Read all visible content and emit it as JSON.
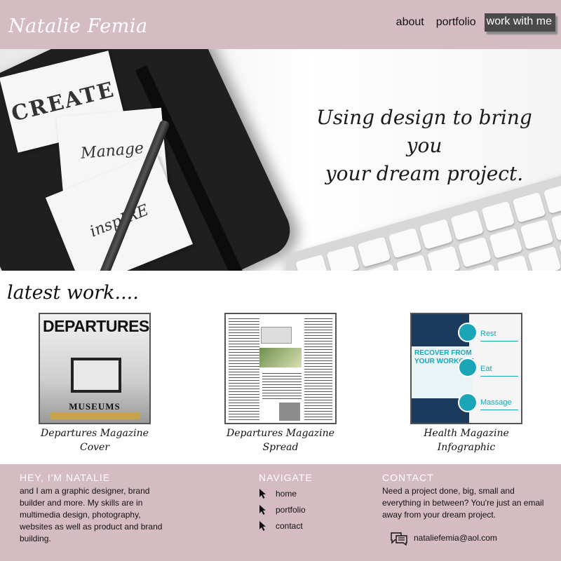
{
  "header": {
    "logo": "Natalie Femia",
    "nav": [
      {
        "label": "about"
      },
      {
        "label": "portfolio"
      },
      {
        "label": "work with me"
      }
    ]
  },
  "hero": {
    "tagline_line1": "Using design to bring you",
    "tagline_line2": "your dream project.",
    "papers": [
      "CREATE",
      "Manage",
      "inspIRE"
    ]
  },
  "latest": {
    "title": "latest work....",
    "items": [
      {
        "caption_line1": "Departures Magazine",
        "caption_line2": "Cover",
        "thumb_title": "DEPARTURES",
        "thumb_sub": "MUSEUMS"
      },
      {
        "caption_line1": "Departures Magazine",
        "caption_line2": "Spread"
      },
      {
        "caption_line1": "Health Magazine",
        "caption_line2": "Infographic",
        "thumb_title": "RECOVER FROM YOUR WORKOUT",
        "thumb_labels": [
          "Rest",
          "Eat",
          "Massage"
        ]
      }
    ]
  },
  "footer": {
    "about_heading": "HEY, I'M NATALIE",
    "about_text": "and I am a graphic designer, brand builder and more. My skills are in multimedia design, photography, websites as well as product and brand building.",
    "navigate_heading": "NAVIGATE",
    "navigate_items": [
      "home",
      "portfolio",
      "contact"
    ],
    "contact_heading": "CONTACT",
    "contact_text": "Need a project done, big, small and everything in between? You're just an email away from your dream project.",
    "email": "nataliefemia@aol.com"
  },
  "colors": {
    "brand": "#d5bcc2",
    "cta": "#4a4a4a",
    "accent": "#1aa6b7"
  }
}
